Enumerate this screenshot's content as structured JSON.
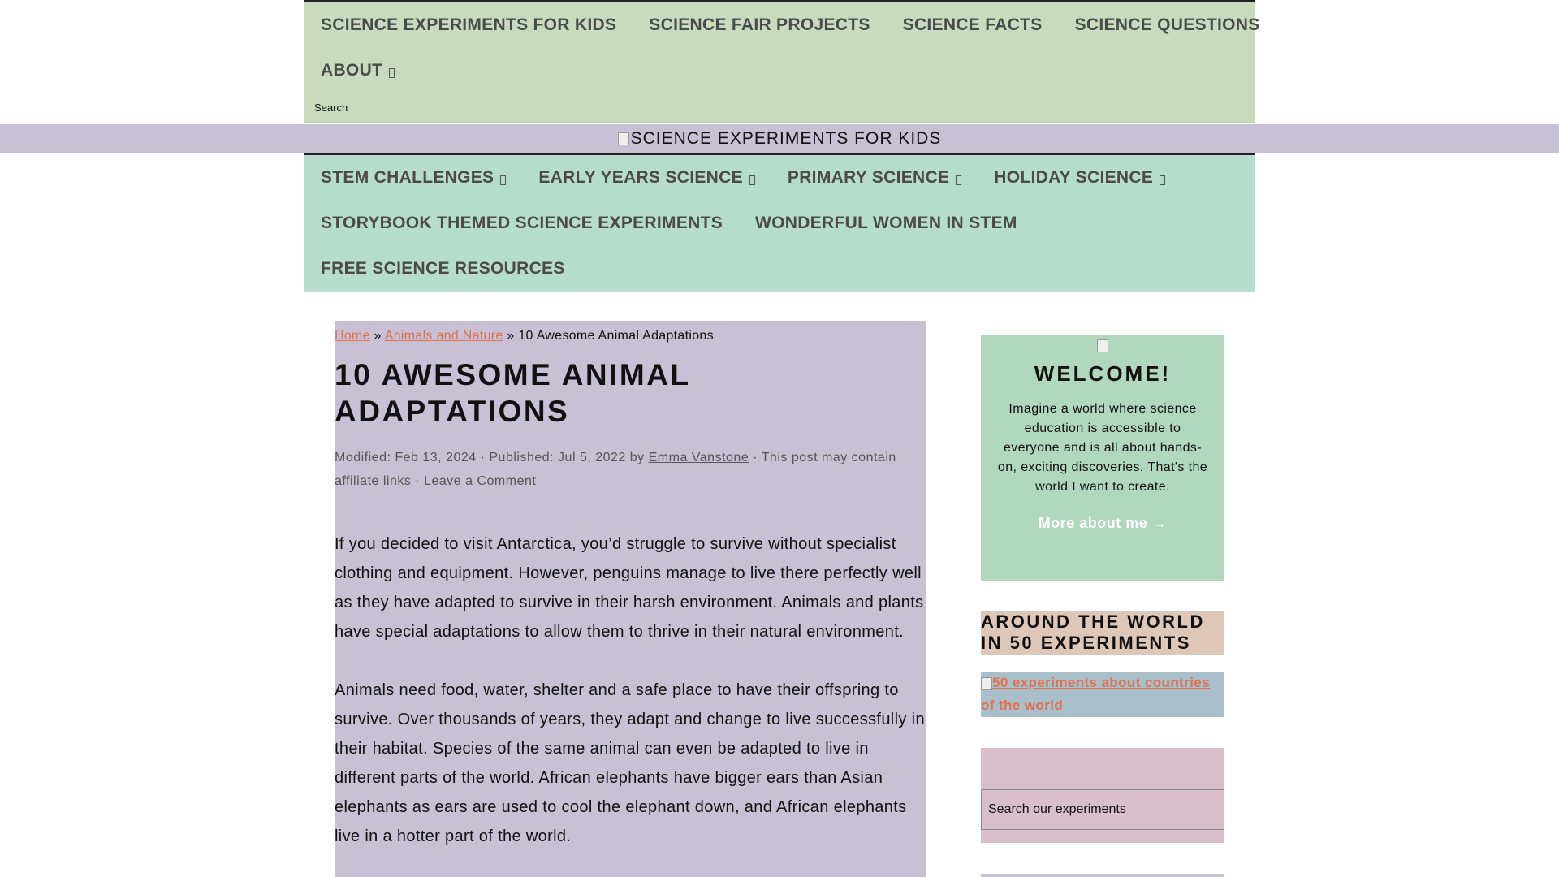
{
  "top_nav": {
    "row1": [
      {
        "label": "SCIENCE EXPERIMENTS FOR KIDS"
      },
      {
        "label": "SCIENCE FAIR PROJECTS"
      },
      {
        "label": "SCIENCE FACTS"
      },
      {
        "label": "SCIENCE QUESTIONS"
      }
    ],
    "row2": [
      {
        "label": "ABOUT"
      }
    ]
  },
  "search": {
    "placeholder": "Search"
  },
  "logo": {
    "alt_text": "SCIENCE EXPERIMENTS FOR KIDS"
  },
  "second_nav": {
    "row1": [
      {
        "label": "STEM CHALLENGES"
      },
      {
        "label": "EARLY YEARS SCIENCE"
      },
      {
        "label": "PRIMARY SCIENCE"
      },
      {
        "label": "HOLIDAY SCIENCE"
      }
    ],
    "row2": [
      {
        "label": "STORYBOOK THEMED SCIENCE EXPERIMENTS"
      },
      {
        "label": "WONDERFUL WOMEN IN STEM"
      }
    ],
    "row3": [
      {
        "label": "FREE SCIENCE RESOURCES"
      }
    ]
  },
  "breadcrumb": {
    "home": "Home",
    "sep1": "»",
    "category": "Animals and Nature",
    "sep2": "»",
    "current": "10 Awesome Animal Adaptations"
  },
  "post": {
    "title": "10 AWESOME ANIMAL ADAPTATIONS",
    "meta": {
      "modified": "Modified: Feb 13, 2024 · Published: Jul 5, 2022 by ",
      "author": "Emma Vanstone",
      "affiliate": " · This post may contain affiliate links · ",
      "comment_link": "Leave a Comment"
    },
    "paragraphs": [
      "If you decided to visit Antarctica, you’d struggle to survive without specialist clothing and equipment. However, penguins manage to live there perfectly well as they have adapted to survive in their harsh environment. Animals and plants have special adaptations to allow them to thrive in their natural environment.",
      "Animals need food, water, shelter and a safe place to have their offspring to survive. Over thousands of years, they adapt and change to live successfully in their habitat. Species of the same animal can even be adapted to live in different parts of the world. African elephants have bigger ears than Asian elephants as ears are used to cool the elephant down, and African elephants live in a hotter part of the world."
    ]
  },
  "sidebar": {
    "welcome": {
      "heading": "WELCOME!",
      "text": "Imagine a world where science education is accessible to everyone and is all about hands-on, exciting discoveries. That's the world I want to create.",
      "more_link": "More about me →"
    },
    "world": {
      "heading": "AROUND THE WORLD IN 50 EXPERIMENTS",
      "image_alt": "50 experiments about countries of the world"
    },
    "search": {
      "placeholder": "Search our experiments"
    }
  },
  "colors": {
    "top_nav_bg": "#c8dcbd",
    "logo_band_bg": "#c8c0d5",
    "second_nav_bg": "#b6dccd",
    "content_bg": "#c8c0d5",
    "welcome_bg": "#b1d7bf",
    "world_heading_bg": "#dfc7b7",
    "world_link_bg": "#a9bfc9",
    "sidebar_search_bg": "#d9bfcc",
    "link": "#e0704f"
  }
}
